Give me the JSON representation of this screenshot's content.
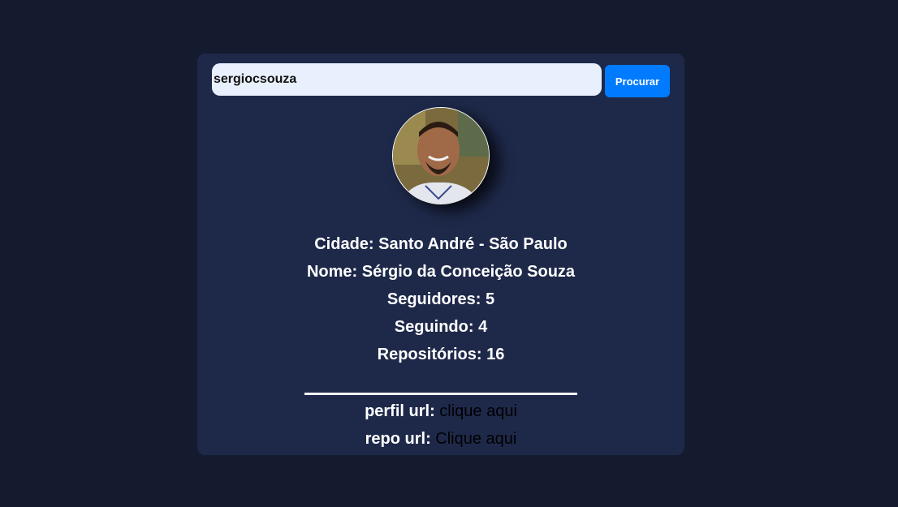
{
  "search": {
    "value": "sergiocsouza",
    "button_label": "Procurar"
  },
  "profile": {
    "city_label": "Cidade:",
    "city": "Santo André - São Paulo",
    "name_label": "Nome:",
    "name": "Sérgio da Conceição Souza",
    "followers_label": "Seguidores:",
    "followers": "5",
    "following_label": "Seguindo:",
    "following": "4",
    "repos_label": "Repositórios:",
    "repos": "16"
  },
  "links": {
    "profile_label": "perfil url:",
    "profile_link": "clique aqui",
    "repo_label": "repo url:",
    "repo_link": "Clique aqui"
  },
  "colors": {
    "page_background": "#141b2e",
    "card_background": "#1e294a",
    "button": "#007bff",
    "input_background": "#e8f0fe"
  }
}
